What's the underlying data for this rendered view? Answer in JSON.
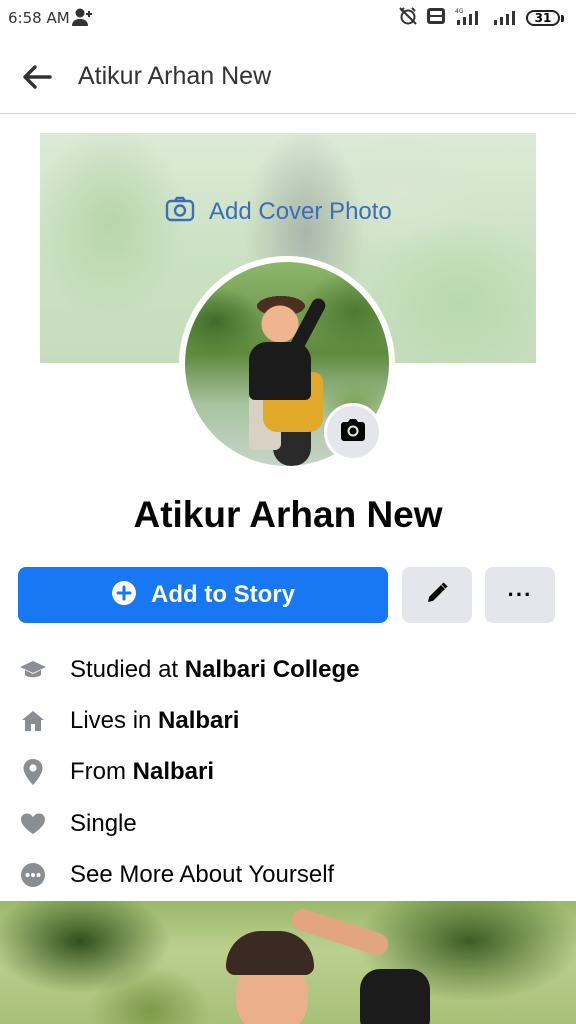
{
  "status_bar": {
    "time": "6:58 AM",
    "network": "4G",
    "battery": "31"
  },
  "header": {
    "title": "Atikur Arhan New"
  },
  "cover": {
    "add_cover_label": "Add Cover Photo"
  },
  "profile": {
    "name": "Atikur Arhan New"
  },
  "actions": {
    "add_story_label": "Add to Story",
    "more_label": "···"
  },
  "details": [
    {
      "icon": "graduation-cap-icon",
      "prefix": "Studied at ",
      "bold": "Nalbari College"
    },
    {
      "icon": "home-icon",
      "prefix": "Lives in ",
      "bold": "Nalbari"
    },
    {
      "icon": "location-pin-icon",
      "prefix": "From ",
      "bold": "Nalbari"
    },
    {
      "icon": "heart-icon",
      "prefix": "Single",
      "bold": ""
    },
    {
      "icon": "more-dots-icon",
      "prefix": "See More About Yourself",
      "bold": ""
    }
  ],
  "colors": {
    "primary": "#1877f2",
    "secondary_button": "#e4e6eb",
    "icon_gray": "#8a8d91",
    "link_blue": "#3a6fb5"
  }
}
